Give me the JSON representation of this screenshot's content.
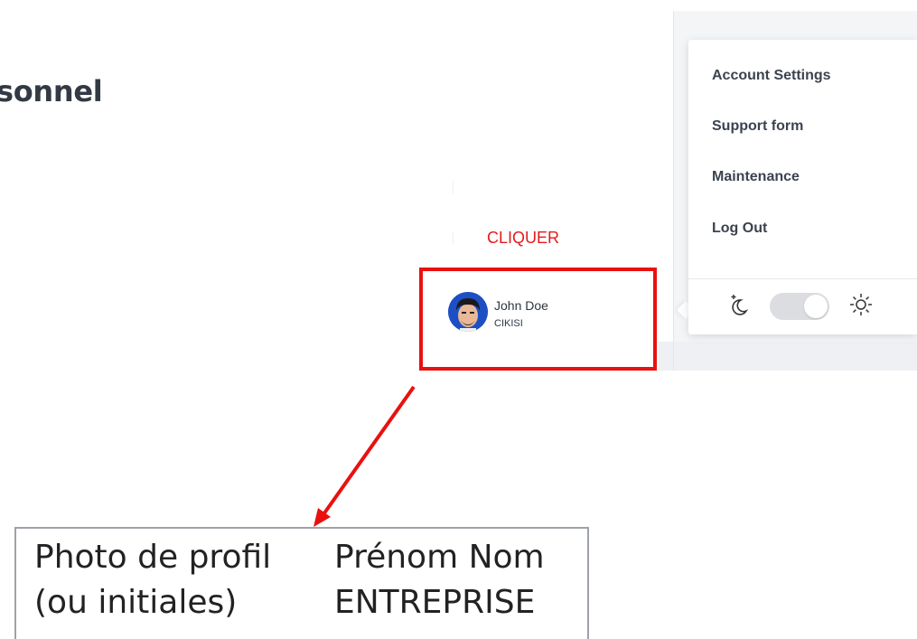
{
  "heading": "sonnel",
  "dropdown": {
    "items": [
      {
        "label": "Account Settings"
      },
      {
        "label": "Support form"
      },
      {
        "label": "Maintenance"
      },
      {
        "label": "Log Out"
      }
    ],
    "theme": {
      "moon_icon": "moon-icon",
      "sun_icon": "sun-icon",
      "toggle_state": "light"
    }
  },
  "annotation": {
    "click_label": "CLIQUER",
    "highlight_color": "#e8110f"
  },
  "profile": {
    "name": "John Doe",
    "company": "CIKISI",
    "avatar_icon": "avatar"
  },
  "legend": {
    "photo_line1": "Photo de profil",
    "photo_line2": "(ou initiales)",
    "name_line1": "Prénom Nom",
    "name_line2": "ENTREPRISE"
  }
}
